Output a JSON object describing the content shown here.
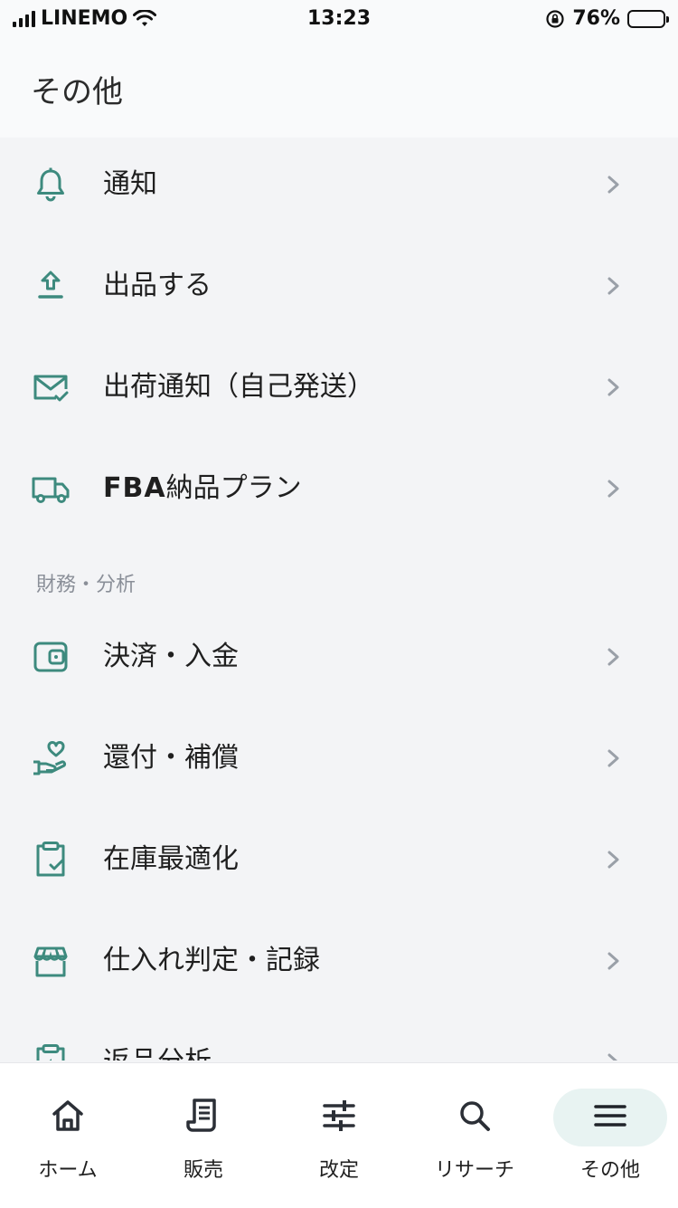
{
  "status_bar": {
    "carrier": "LINEMO",
    "time": "13:23",
    "battery_percent": "76%",
    "battery_level": 0.76
  },
  "header": {
    "title": "その他"
  },
  "menu": {
    "items": [
      {
        "label": "通知",
        "icon": "bell-icon"
      },
      {
        "label": "出品する",
        "icon": "upload-icon"
      },
      {
        "label": "出荷通知（自己発送）",
        "icon": "mail-check-icon"
      },
      {
        "label_prefix": "FBA",
        "label_suffix": "納品プラン",
        "icon": "truck-icon"
      }
    ],
    "section_finance": "財務・分析",
    "finance_items": [
      {
        "label": "決済・入金",
        "icon": "wallet-icon"
      },
      {
        "label": "還付・補償",
        "icon": "hand-heart-icon"
      },
      {
        "label": "在庫最適化",
        "icon": "clipboard-check-icon"
      },
      {
        "label": "仕入れ判定・記録",
        "icon": "store-icon"
      },
      {
        "label": "返品分析",
        "icon": "clipboard-return-icon"
      }
    ]
  },
  "bottom_nav": [
    {
      "label": "ホーム",
      "icon": "home-icon"
    },
    {
      "label": "販売",
      "icon": "receipt-icon"
    },
    {
      "label": "改定",
      "icon": "sliders-icon"
    },
    {
      "label": "リサーチ",
      "icon": "search-icon"
    },
    {
      "label": "その他",
      "icon": "menu-icon",
      "active": true
    }
  ],
  "colors": {
    "accent": "#3d8a7e",
    "active_pill": "#e8f3f2",
    "chevron": "#9aa0a8"
  }
}
